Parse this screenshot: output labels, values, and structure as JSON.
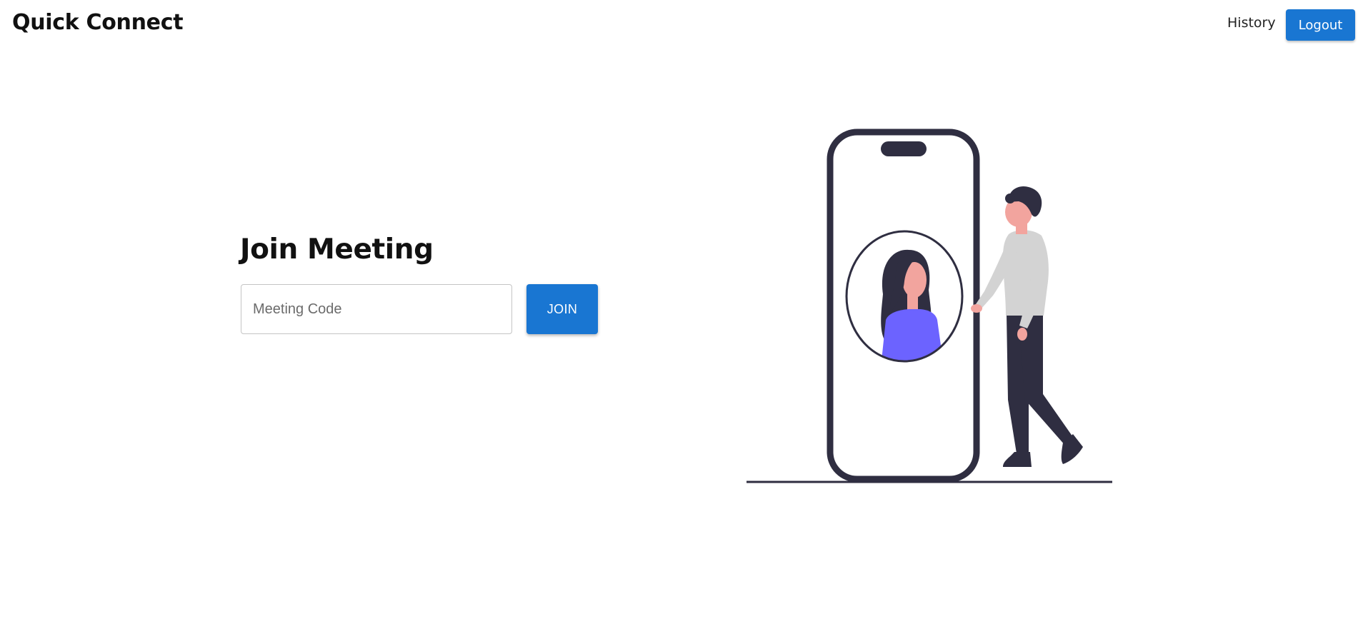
{
  "navbar": {
    "brand": "Quick Connect",
    "history_label": "History",
    "logout_label": "Logout"
  },
  "main": {
    "title": "Join Meeting",
    "code_input": {
      "placeholder": "Meeting Code",
      "value": ""
    },
    "join_label": "JOIN"
  },
  "illustration": {
    "name": "video-call-illustration",
    "colors": {
      "dark": "#2f2e41",
      "skin": "#f2a49e",
      "shirt": "#6c63ff",
      "sweater": "#d3d3d3",
      "outline": "#3f3d56"
    }
  },
  "theme": {
    "primary": "#1976d2"
  }
}
